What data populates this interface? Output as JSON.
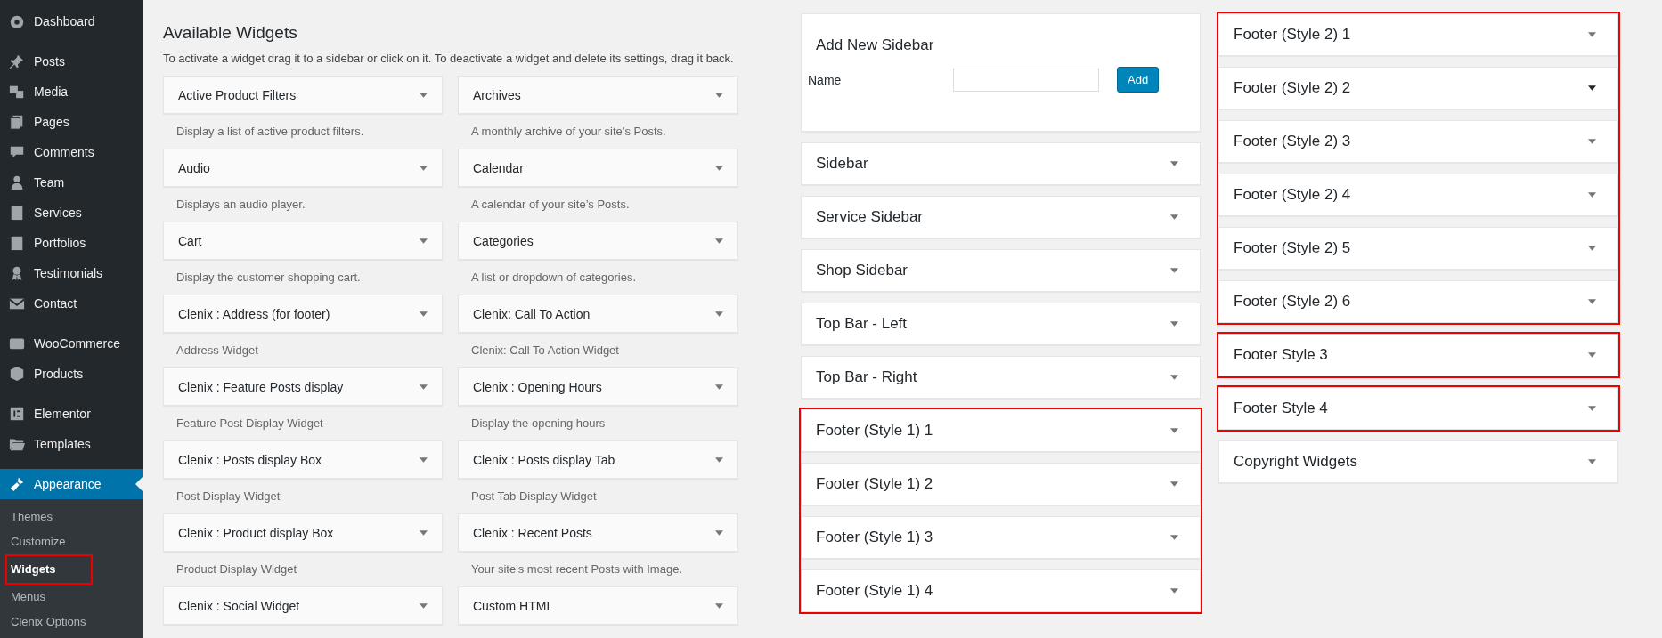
{
  "admin_menu": {
    "groups": [
      [
        {
          "label": "Dashboard",
          "selected": false
        }
      ],
      [
        {
          "label": "Posts",
          "selected": false
        },
        {
          "label": "Media",
          "selected": false
        },
        {
          "label": "Pages",
          "selected": false
        },
        {
          "label": "Comments",
          "selected": false
        },
        {
          "label": "Team",
          "selected": false
        },
        {
          "label": "Services",
          "selected": false
        },
        {
          "label": "Portfolios",
          "selected": false
        },
        {
          "label": "Testimonials",
          "selected": false
        },
        {
          "label": "Contact",
          "selected": false
        }
      ],
      [
        {
          "label": "WooCommerce",
          "selected": false
        },
        {
          "label": "Products",
          "selected": false
        }
      ],
      [
        {
          "label": "Elementor",
          "selected": false
        },
        {
          "label": "Templates",
          "selected": false
        }
      ],
      [
        {
          "label": "Appearance",
          "selected": true
        }
      ]
    ],
    "submenu": [
      {
        "label": "Themes",
        "selected": false,
        "highlighted": false
      },
      {
        "label": "Customize",
        "selected": false,
        "highlighted": false
      },
      {
        "label": "Widgets",
        "selected": true,
        "highlighted": true
      },
      {
        "label": "Menus",
        "selected": false,
        "highlighted": false
      },
      {
        "label": "Clenix Options",
        "selected": false,
        "highlighted": false
      }
    ]
  },
  "available_widgets": {
    "title": "Available Widgets",
    "description": "To activate a widget drag it to a sidebar or click on it. To deactivate a widget and delete its settings, drag it back.",
    "widgets": [
      {
        "title": "Active Product Filters",
        "description": "Display a list of active product filters."
      },
      {
        "title": "Archives",
        "description": "A monthly archive of your site’s Posts."
      },
      {
        "title": "Audio",
        "description": "Displays an audio player."
      },
      {
        "title": "Calendar",
        "description": "A calendar of your site’s Posts."
      },
      {
        "title": "Cart",
        "description": "Display the customer shopping cart."
      },
      {
        "title": "Categories",
        "description": "A list or dropdown of categories."
      },
      {
        "title": "Clenix : Address (for footer)",
        "description": "Address Widget"
      },
      {
        "title": "Clenix: Call To Action",
        "description": "Clenix: Call To Action Widget"
      },
      {
        "title": "Clenix : Feature Posts display",
        "description": "Feature Post Display Widget"
      },
      {
        "title": "Clenix : Opening Hours",
        "description": "Display the opening hours"
      },
      {
        "title": "Clenix : Posts display Box",
        "description": "Post Display Widget"
      },
      {
        "title": "Clenix : Posts display Tab",
        "description": "Post Tab Display Widget"
      },
      {
        "title": "Clenix : Product display Box",
        "description": "Product Display Widget"
      },
      {
        "title": "Clenix : Recent Posts",
        "description": "Your site’s most recent Posts with Image."
      },
      {
        "title": "Clenix : Social Widget"
      },
      {
        "title": "Custom HTML"
      }
    ]
  },
  "sidebar_columns": [
    {
      "add_sidebar": {
        "title": "Add New Sidebar",
        "name_label": "Name",
        "button": "Add"
      },
      "groups": [
        {
          "highlighted": false,
          "sidebars": [
            {
              "title": "Sidebar",
              "hovered": false
            }
          ]
        },
        {
          "highlighted": false,
          "sidebars": [
            {
              "title": "Service Sidebar",
              "hovered": false
            }
          ]
        },
        {
          "highlighted": false,
          "sidebars": [
            {
              "title": "Shop Sidebar",
              "hovered": false
            }
          ]
        },
        {
          "highlighted": false,
          "sidebars": [
            {
              "title": "Top Bar - Left",
              "hovered": false
            }
          ]
        },
        {
          "highlighted": false,
          "sidebars": [
            {
              "title": "Top Bar - Right",
              "hovered": false
            }
          ]
        },
        {
          "highlighted": true,
          "sidebars": [
            {
              "title": "Footer (Style 1) 1",
              "hovered": false
            },
            {
              "title": "Footer (Style 1) 2",
              "hovered": false
            },
            {
              "title": "Footer (Style 1) 3",
              "hovered": false
            },
            {
              "title": "Footer (Style 1) 4",
              "hovered": false
            }
          ]
        }
      ]
    },
    {
      "groups": [
        {
          "highlighted": true,
          "sidebars": [
            {
              "title": "Footer (Style 2) 1",
              "hovered": false
            },
            {
              "title": "Footer (Style 2) 2",
              "hovered": true
            },
            {
              "title": "Footer (Style 2) 3",
              "hovered": false
            },
            {
              "title": "Footer (Style 2) 4",
              "hovered": false
            },
            {
              "title": "Footer (Style 2) 5",
              "hovered": false
            },
            {
              "title": "Footer (Style 2) 6",
              "hovered": false
            }
          ]
        },
        {
          "highlighted": true,
          "sidebars": [
            {
              "title": "Footer Style 3",
              "hovered": false
            }
          ]
        },
        {
          "highlighted": true,
          "sidebars": [
            {
              "title": "Footer Style 4",
              "hovered": false
            }
          ]
        },
        {
          "highlighted": false,
          "sidebars": [
            {
              "title": "Copyright Widgets",
              "hovered": false
            }
          ]
        }
      ]
    }
  ]
}
